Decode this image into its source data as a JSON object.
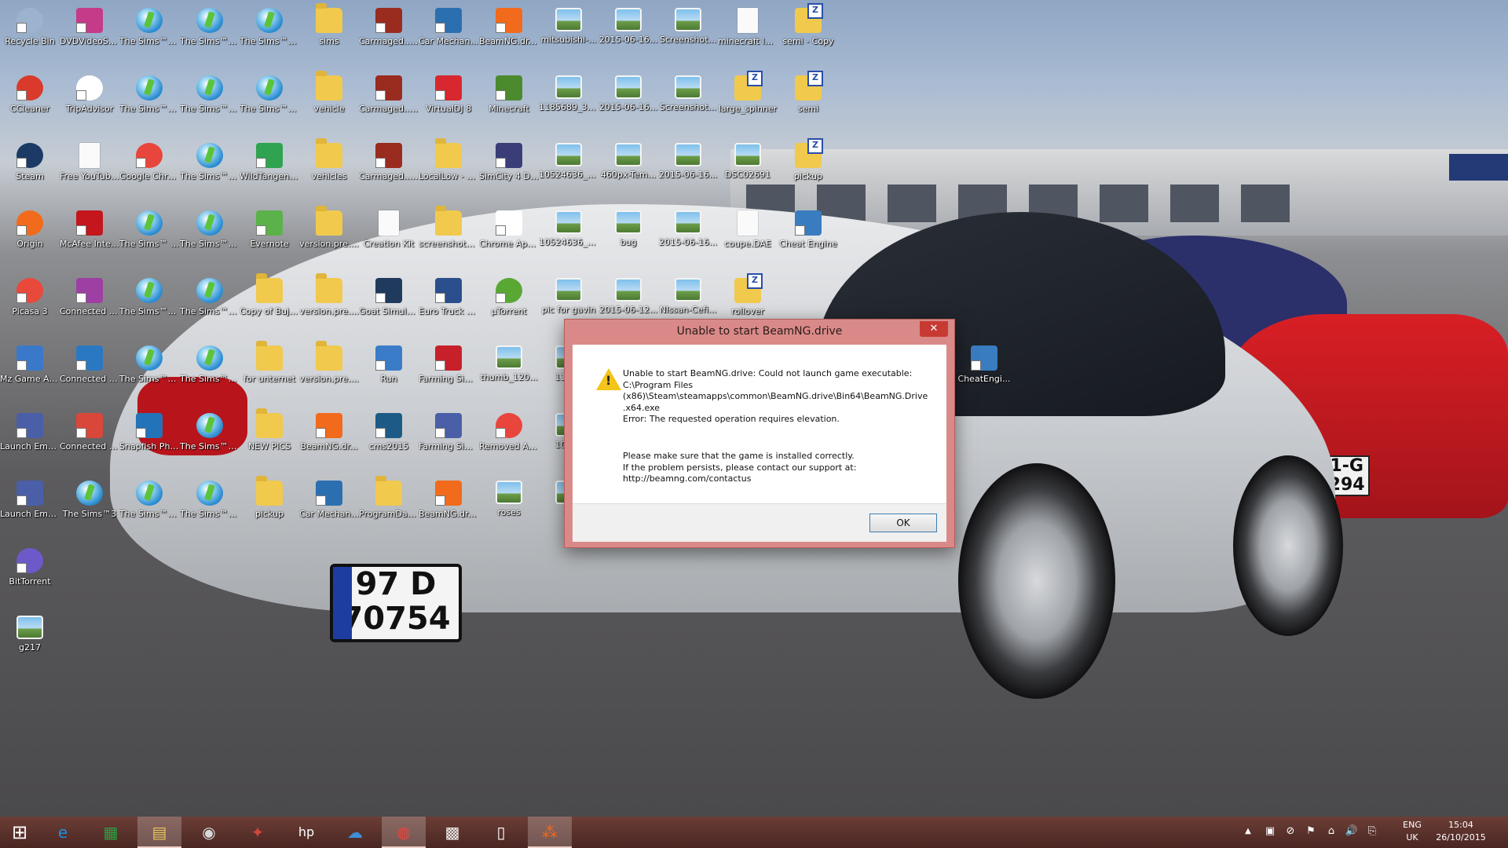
{
  "desktop": {
    "columns": [
      [
        {
          "label": "Recycle Bin",
          "icon": "recycle-bin-icon",
          "kind": "round",
          "color": "#9bb3cf"
        },
        {
          "label": "CCleaner",
          "icon": "ccleaner-icon",
          "kind": "round",
          "color": "#d93a2b"
        },
        {
          "label": "Steam",
          "icon": "steam-icon",
          "kind": "round",
          "color": "#1b3b66"
        },
        {
          "label": "Origin",
          "icon": "origin-icon",
          "kind": "round",
          "color": "#f26a1b"
        },
        {
          "label": "Picasa 3",
          "icon": "picasa-icon",
          "kind": "round",
          "color": "#e8493b"
        },
        {
          "label": "Mz Game Accelerator",
          "icon": "game-accelerator-icon",
          "kind": "app",
          "color": "#3a79c9"
        },
        {
          "label": "Launch Empire Ear...",
          "icon": "empire-earth-icon",
          "kind": "app",
          "color": "#4a5fa8"
        },
        {
          "label": "Launch Empire Ear...",
          "icon": "empire-earth-icon",
          "kind": "app",
          "color": "#4a5fa8"
        },
        {
          "label": "BitTorrent",
          "icon": "bittorrent-icon",
          "kind": "round",
          "color": "#6e59c8"
        },
        {
          "label": "g217",
          "icon": "image-file-icon",
          "kind": "image",
          "color": "#7fc0ec"
        }
      ],
      [
        {
          "label": "DVDVideoS... Free Studio",
          "icon": "dvdvideosoft-icon",
          "kind": "app",
          "color": "#c53a89"
        },
        {
          "label": "TripAdvisor",
          "icon": "tripadvisor-icon",
          "kind": "round",
          "color": "#ffffff"
        },
        {
          "label": "Free YouTube ...",
          "icon": "youtube-downloader-icon",
          "kind": "doc",
          "color": "#ffffff"
        },
        {
          "label": "McAfee Intern...",
          "icon": "mcafee-icon",
          "kind": "app",
          "color": "#c4161c"
        },
        {
          "label": "Connected Photo",
          "icon": "connected-photo-icon",
          "kind": "app",
          "color": "#9d3fa3"
        },
        {
          "label": "Connected Drive",
          "icon": "connected-drive-icon",
          "kind": "app",
          "color": "#2b78c2"
        },
        {
          "label": "Connected Music",
          "icon": "connected-music-icon",
          "kind": "app",
          "color": "#d9473a"
        },
        {
          "label": "The Sims™3",
          "icon": "sims3-icon",
          "kind": "sims",
          "color": "#2a8bd0"
        }
      ],
      [
        {
          "label": "The Sims™3 Pets",
          "icon": "sims3-icon",
          "kind": "sims",
          "color": "#2a8bd0"
        },
        {
          "label": "The Sims™3 Seasons",
          "icon": "sims3-icon",
          "kind": "sims",
          "color": "#e58a2b"
        },
        {
          "label": "Google Chrome",
          "icon": "chrome-icon",
          "kind": "round",
          "color": "#e8453c"
        },
        {
          "label": "The Sims™ Medieval",
          "icon": "sims-medieval-icon",
          "kind": "sims",
          "color": "#6a8a2f"
        },
        {
          "label": "The Sims™3 Ambitions",
          "icon": "sims3-icon",
          "kind": "sims",
          "color": "#2a8bd0"
        },
        {
          "label": "The Sims™3 Late Night",
          "icon": "sims3-icon",
          "kind": "sims",
          "color": "#8e3fa1"
        },
        {
          "label": "Snapfish Photos",
          "icon": "snapfish-icon",
          "kind": "app",
          "color": "#2273b8"
        },
        {
          "label": "The Sims™3 Generations",
          "icon": "sims3-icon",
          "kind": "sims",
          "color": "#e58a2b"
        }
      ],
      [
        {
          "label": "The Sims™3 Diesel Stuff",
          "icon": "sims3-icon",
          "kind": "sims",
          "color": "#7c8a39"
        },
        {
          "label": "The Sims™3 Supernatural",
          "icon": "sims3-icon",
          "kind": "sims",
          "color": "#3b7b3a"
        },
        {
          "label": "The Sims™3 World Adv...",
          "icon": "sims3-icon",
          "kind": "sims",
          "color": "#4a9a3a"
        },
        {
          "label": "The Sims™3 Fast Lane ...",
          "icon": "sims3-icon",
          "kind": "sims",
          "color": "#2a8bd0"
        },
        {
          "label": "The Sims™3 Island Para...",
          "icon": "sims3-icon",
          "kind": "sims",
          "color": "#2a8bd0"
        },
        {
          "label": "The Sims™3 Town Life ...",
          "icon": "sims3-icon",
          "kind": "sims",
          "color": "#2a8bd0"
        },
        {
          "label": "The Sims™3 University ...",
          "icon": "sims3-icon",
          "kind": "sims",
          "color": "#e58a2b"
        },
        {
          "label": "The Sims™3 High-End ...",
          "icon": "sims3-icon",
          "kind": "sims",
          "color": "#2a8bd0"
        }
      ],
      [
        {
          "label": "The Sims™3 Outdoor Li...",
          "icon": "sims3-icon",
          "kind": "sims",
          "color": "#2a8bd0"
        },
        {
          "label": "The Sims™3 70s, 80s, &...",
          "icon": "sims3-icon",
          "kind": "sims",
          "color": "#b449b0"
        },
        {
          "label": "WildTangent Games for ...",
          "icon": "wildtangent-icon",
          "kind": "app",
          "color": "#2fa34f"
        },
        {
          "label": "Evernote",
          "icon": "evernote-icon",
          "kind": "app",
          "color": "#5bb24a"
        },
        {
          "label": "Copy of Bujern",
          "icon": "folder-icon",
          "kind": "folder",
          "color": "#f1c94d"
        },
        {
          "label": "for unternet",
          "icon": "folder-icon",
          "kind": "folder",
          "color": "#f1c94d"
        },
        {
          "label": "NEW PICS",
          "icon": "folder-icon",
          "kind": "folder",
          "color": "#f1c94d"
        },
        {
          "label": "pickup",
          "icon": "folder-icon",
          "kind": "folder",
          "color": "#f1c94d"
        }
      ],
      [
        {
          "label": "sims",
          "icon": "folder-icon",
          "kind": "folder",
          "color": "#f1c94d"
        },
        {
          "label": "vehicle",
          "icon": "folder-icon",
          "kind": "folder",
          "color": "#f1c94d"
        },
        {
          "label": "vehicles",
          "icon": "folder-icon",
          "kind": "folder",
          "color": "#f1c94d"
        },
        {
          "label": "version.pre....",
          "icon": "folder-icon",
          "kind": "folder",
          "color": "#f1c94d"
        },
        {
          "label": "version.pre....",
          "icon": "folder-icon",
          "kind": "folder",
          "color": "#f1c94d"
        },
        {
          "label": "version.pre....",
          "icon": "folder-icon",
          "kind": "folder",
          "color": "#f1c94d"
        },
        {
          "label": "BeamNG.dr...",
          "icon": "beamng-icon",
          "kind": "app",
          "color": "#f26a1b"
        },
        {
          "label": "Car Mechan...",
          "icon": "car-mechanic-icon",
          "kind": "app",
          "color": "#2c6fb0"
        }
      ],
      [
        {
          "label": "Carmaged... 2 Carpocaly...",
          "icon": "carmageddon-icon",
          "kind": "app",
          "color": "#9a2b1f"
        },
        {
          "label": "Carmaged... Reincarnati...",
          "icon": "carmageddon-icon",
          "kind": "app",
          "color": "#9a2b1f"
        },
        {
          "label": "Carmaged... TDR 2000",
          "icon": "carmageddon-icon",
          "kind": "app",
          "color": "#9a2b1f"
        },
        {
          "label": "Creation Kit",
          "icon": "creation-kit-icon",
          "kind": "doc",
          "color": "#ffffff"
        },
        {
          "label": "Goat Simulator",
          "icon": "goat-simulator-icon",
          "kind": "app",
          "color": "#1f3a5c"
        },
        {
          "label": "Run",
          "icon": "run-icon",
          "kind": "app",
          "color": "#3b7cc9"
        },
        {
          "label": "cms2015",
          "icon": "cms2015-icon",
          "kind": "app",
          "color": "#1d5b86"
        },
        {
          "label": "ProgramData - Shortcut",
          "icon": "folder-shortcut-icon",
          "kind": "folder",
          "color": "#f1c94d"
        }
      ],
      [
        {
          "label": "Car Mechan...",
          "icon": "car-mechanic-icon",
          "kind": "app",
          "color": "#2c6fb0"
        },
        {
          "label": "VirtualDJ 8",
          "icon": "virtualdj-icon",
          "kind": "app",
          "color": "#d8272f"
        },
        {
          "label": "LocalLow - Shortcut",
          "icon": "folder-shortcut-icon",
          "kind": "folder",
          "color": "#f1c94d"
        },
        {
          "label": "screenshots - Shortcut",
          "icon": "folder-shortcut-icon",
          "kind": "folder",
          "color": "#f1c94d"
        },
        {
          "label": "Euro Truck Simulator 2",
          "icon": "euro-truck-icon",
          "kind": "app",
          "color": "#2b4f8c"
        },
        {
          "label": "Farming Simulator ...",
          "icon": "farming-simulator-icon",
          "kind": "app",
          "color": "#c8202a"
        },
        {
          "label": "Farming Simulator 15",
          "icon": "farming-simulator-icon",
          "kind": "app",
          "color": "#4a5fa8"
        },
        {
          "label": "BeamNG.dr... - Shortcut",
          "icon": "beamng-icon",
          "kind": "app",
          "color": "#f26a1b"
        }
      ],
      [
        {
          "label": "BeamNG.dr... - Shortcut",
          "icon": "beamng-icon",
          "kind": "app",
          "color": "#f26a1b"
        },
        {
          "label": "Minecraft",
          "icon": "minecraft-icon",
          "kind": "app",
          "color": "#4d8a2e"
        },
        {
          "label": "SimCity 4 Deluxe",
          "icon": "simcity-icon",
          "kind": "app",
          "color": "#3a3d78"
        },
        {
          "label": "Chrome App Launcher",
          "icon": "app-launcher-icon",
          "kind": "app",
          "color": "#ffffff"
        },
        {
          "label": "µTorrent",
          "icon": "utorrent-icon",
          "kind": "round",
          "color": "#5aa834"
        },
        {
          "label": "thumb_120...",
          "icon": "image-file-icon",
          "kind": "image",
          "color": "#7fc0ec"
        },
        {
          "label": "Removed Applications",
          "icon": "chrome-icon",
          "kind": "round",
          "color": "#e8453c"
        },
        {
          "label": "roses",
          "icon": "image-file-icon",
          "kind": "image",
          "color": "#7fc0ec"
        }
      ],
      [
        {
          "label": "mitsubishi-...",
          "icon": "image-file-icon",
          "kind": "image",
          "color": "#7fc0ec"
        },
        {
          "label": "1185689_30...",
          "icon": "image-file-icon",
          "kind": "image",
          "color": "#7fc0ec"
        },
        {
          "label": "10524636_4...",
          "icon": "image-file-icon",
          "kind": "image",
          "color": "#7fc0ec"
        },
        {
          "label": "10524636_4...",
          "icon": "image-file-icon",
          "kind": "image",
          "color": "#7fc0ec"
        },
        {
          "label": "pic for gavin",
          "icon": "image-file-icon",
          "kind": "image",
          "color": "#7fc0ec"
        },
        {
          "label": "11856",
          "icon": "image-file-icon",
          "kind": "image",
          "color": "#7fc0ec"
        },
        {
          "label": "10524",
          "icon": "image-file-icon",
          "kind": "image",
          "color": "#7fc0ec"
        },
        {
          "label": "pr",
          "icon": "image-file-icon",
          "kind": "image",
          "color": "#7fc0ec"
        }
      ],
      [
        {
          "label": "2015-06-16...",
          "icon": "image-file-icon",
          "kind": "image",
          "color": "#7fc0ec"
        },
        {
          "label": "2015-06-16...",
          "icon": "image-file-icon",
          "kind": "image",
          "color": "#7fc0ec"
        },
        {
          "label": "460px-Tem...",
          "icon": "image-file-icon",
          "kind": "image",
          "color": "#7fc0ec"
        },
        {
          "label": "bug",
          "icon": "image-file-icon",
          "kind": "image",
          "color": "#7fc0ec"
        },
        {
          "label": "2015-06-12...",
          "icon": "image-file-icon",
          "kind": "image",
          "color": "#7fc0ec"
        }
      ],
      [
        {
          "label": "Screenshot...",
          "icon": "image-file-icon",
          "kind": "image",
          "color": "#7fc0ec"
        },
        {
          "label": "Screenshot...",
          "icon": "image-file-icon",
          "kind": "image",
          "color": "#7fc0ec"
        },
        {
          "label": "2015-06-16...",
          "icon": "image-file-icon",
          "kind": "image",
          "color": "#7fc0ec"
        },
        {
          "label": "2015-06-16...",
          "icon": "image-file-icon",
          "kind": "image",
          "color": "#7fc0ec"
        },
        {
          "label": "NIssan-Cefi...",
          "icon": "image-file-icon",
          "kind": "image",
          "color": "#7fc0ec"
        }
      ],
      [
        {
          "label": "minecraft launcher",
          "icon": "minecraft-launcher-icon",
          "kind": "doc",
          "color": "#ffffff"
        },
        {
          "label": "large_spinner",
          "icon": "zip-folder-icon",
          "kind": "zip",
          "color": "#f1c94d"
        },
        {
          "label": "DSC02691",
          "icon": "image-file-icon",
          "kind": "image",
          "color": "#7fc0ec"
        },
        {
          "label": "coupe.DAE",
          "icon": "document-icon",
          "kind": "doc",
          "color": "#ffffff"
        },
        {
          "label": "rollover",
          "icon": "zip-folder-icon",
          "kind": "zip",
          "color": "#f1c94d"
        }
      ],
      [
        {
          "label": "semi - Copy",
          "icon": "zip-folder-icon",
          "kind": "zip",
          "color": "#f1c94d"
        },
        {
          "label": "semi",
          "icon": "zip-folder-icon",
          "kind": "zip",
          "color": "#f1c94d"
        },
        {
          "label": "pickup",
          "icon": "zip-folder-icon",
          "kind": "zip",
          "color": "#f1c94d"
        },
        {
          "label": "Cheat Engine",
          "icon": "cheat-engine-icon",
          "kind": "app",
          "color": "#3a7cc0"
        }
      ]
    ],
    "extra_icon": {
      "label": "CheatEngi...",
      "icon": "cheat-engine-icon",
      "kind": "app",
      "color": "#3a7cc0"
    },
    "wallpaper_plate": {
      "row1": "97 D",
      "row2": "70754",
      "country": "IRL"
    },
    "wallpaper_red_plate": "01-G 1294"
  },
  "dialog": {
    "title": "Unable to start BeamNG.drive",
    "close_glyph": "✕",
    "message": [
      "Unable to start BeamNG.drive: Could not launch game executable:",
      "C:\\Program Files",
      "(x86)\\Steam\\steamapps\\common\\BeamNG.drive\\Bin64\\BeamNG.Drive",
      ".x64.exe",
      "Error: The requested operation requires elevation."
    ],
    "message2": [
      "Please make sure that the game is installed correctly.",
      "If the problem persists, please contact our support at:",
      "http://beamng.com/contactus"
    ],
    "ok_label": "OK"
  },
  "taskbar": {
    "start_glyph": "⊞",
    "apps": [
      {
        "name": "internet-explorer-icon",
        "glyph": "e",
        "color": "#1e8fe0",
        "active": false
      },
      {
        "name": "store-icon",
        "glyph": "▦",
        "color": "#27a442",
        "active": false
      },
      {
        "name": "file-explorer-icon",
        "glyph": "▤",
        "color": "#e7c75a",
        "active": true
      },
      {
        "name": "media-player-icon",
        "glyph": "◉",
        "color": "#d8d8d8",
        "active": false
      },
      {
        "name": "photo-gallery-icon",
        "glyph": "✦",
        "color": "#d2463b",
        "active": false
      },
      {
        "name": "hp-icon",
        "glyph": "hp",
        "color": "#ffffff",
        "active": false
      },
      {
        "name": "onedrive-icon",
        "glyph": "☁",
        "color": "#3d8fd8",
        "active": false
      },
      {
        "name": "chrome-icon",
        "glyph": "◍",
        "color": "#e8453c",
        "active": true
      },
      {
        "name": "app-launcher-icon",
        "glyph": "▩",
        "color": "#f0f0f0",
        "active": false
      },
      {
        "name": "notepad-icon",
        "glyph": "▯",
        "color": "#ffffff",
        "active": false
      },
      {
        "name": "beamng-icon",
        "glyph": "⁂",
        "color": "#f26a1b",
        "active": true
      }
    ],
    "tray": {
      "chevron": "▲",
      "icons": [
        "▣",
        "⊘",
        "⚑",
        "⌂",
        "🔊",
        "⎘"
      ],
      "lang_line1": "ENG",
      "lang_line2": "UK",
      "time": "15:04",
      "date": "26/10/2015"
    }
  }
}
